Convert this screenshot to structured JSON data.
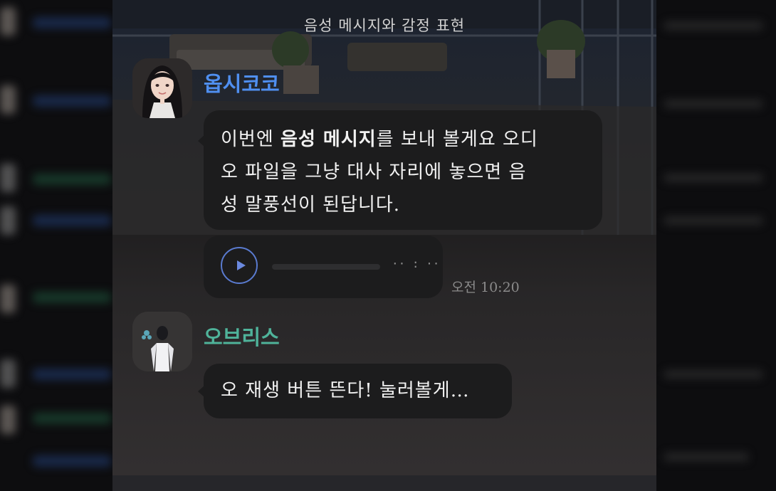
{
  "header": {
    "title": "음성 메시지와 감정 표현"
  },
  "messages": [
    {
      "sender": "옵시코코",
      "sender_color": "#4f8ff0",
      "segments": [
        "이번엔 ",
        "음성 메시지",
        "를 보내 볼게요 오디오 파일을 그냥 대사 자리에 놓으면 음성 말풍선이 된답니다."
      ],
      "line1a": "이번엔 ",
      "line1b": "음성 메시지",
      "line1c": "를 보내 볼게요 오디",
      "line2": "오 파일을 그냥 대사 자리에 놓으면 음",
      "line3": "성 말풍선이 된답니다."
    },
    {
      "sender": "오브리스",
      "sender_color": "#4fb39a",
      "text": "오 재생 버튼 뜬다! 눌러볼게…"
    }
  ],
  "audio": {
    "duration": "·· : ··",
    "progress": 0,
    "play_icon": "play-icon",
    "accent": "#5a7bd0"
  },
  "timestamp": "오전 10:20"
}
